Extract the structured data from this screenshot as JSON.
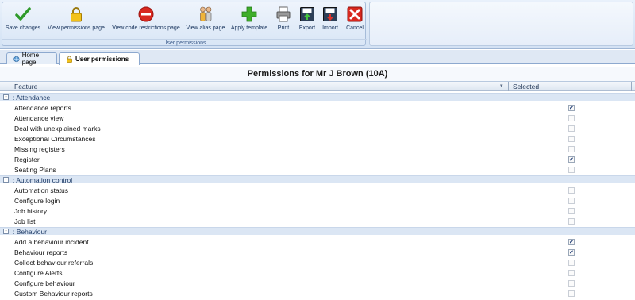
{
  "ribbon": {
    "buttons": [
      {
        "label": "Save changes",
        "icon": "checkmark-icon"
      },
      {
        "label": "View permissions page",
        "icon": "padlock-icon"
      },
      {
        "label": "View code restrictions page",
        "icon": "no-entry-icon"
      },
      {
        "label": "View alias page",
        "icon": "people-icon"
      },
      {
        "label": "Apply template",
        "icon": "plus-icon"
      },
      {
        "label": "Print",
        "icon": "printer-icon"
      },
      {
        "label": "Export",
        "icon": "export-disk-icon"
      },
      {
        "label": "Import",
        "icon": "import-disk-icon"
      },
      {
        "label": "Cancel",
        "icon": "cancel-x-icon"
      }
    ],
    "group_label": "User permissions"
  },
  "tabs": {
    "home": "Home page",
    "user": "User permissions"
  },
  "title": "Permissions for Mr J Brown (10A)",
  "columns": {
    "feature": "Feature",
    "selected": "Selected"
  },
  "groups": [
    {
      "name": ": Attendance",
      "toggle": "-",
      "items": [
        {
          "label": "Attendance reports",
          "checked": true
        },
        {
          "label": "Attendance view",
          "checked": false
        },
        {
          "label": "Deal with unexplained marks",
          "checked": false
        },
        {
          "label": "Exceptional Circumstances",
          "checked": false
        },
        {
          "label": "Missing registers",
          "checked": false
        },
        {
          "label": "Register",
          "checked": true
        },
        {
          "label": "Seating Plans",
          "checked": false
        }
      ]
    },
    {
      "name": ": Automation control",
      "toggle": "-",
      "items": [
        {
          "label": "Automation status",
          "checked": false
        },
        {
          "label": "Configure login",
          "checked": false
        },
        {
          "label": "Job history",
          "checked": false
        },
        {
          "label": "Job list",
          "checked": false
        }
      ]
    },
    {
      "name": ": Behaviour",
      "toggle": "-",
      "items": [
        {
          "label": "Add a behaviour incident",
          "checked": true
        },
        {
          "label": "Behaviour reports",
          "checked": true
        },
        {
          "label": "Collect behaviour referrals",
          "checked": false
        },
        {
          "label": "Configure Alerts",
          "checked": false
        },
        {
          "label": "Configure behaviour",
          "checked": false
        },
        {
          "label": "Custom Behaviour reports",
          "checked": false
        }
      ]
    }
  ],
  "colors": {
    "ribbon_bg": "#d3e2f4",
    "group_row_bg": "#dbe6f4",
    "check_color": "#1f3b73"
  }
}
